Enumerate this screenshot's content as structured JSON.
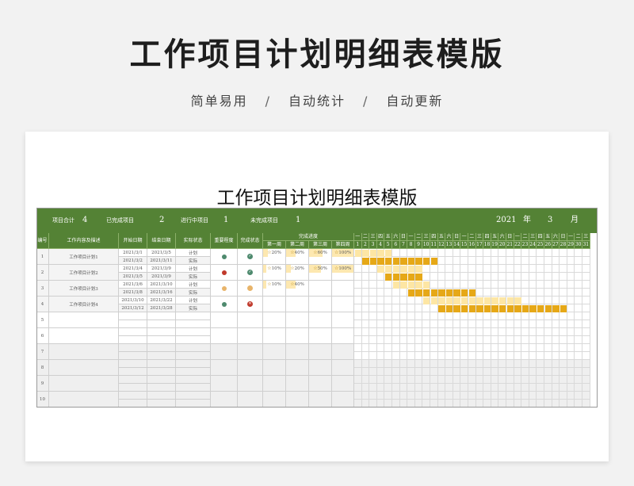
{
  "header": {
    "title": "工作项目计划明细表模版",
    "tagline": [
      "简单易用",
      "自动统计",
      "自动更新"
    ],
    "separator": "/"
  },
  "sheet": {
    "title": "工作项目计划明细表模版"
  },
  "summary": {
    "total_label": "项目合计",
    "total": "4",
    "done_label": "已完成项目",
    "done": "2",
    "progress_label": "进行中项目",
    "progress": "1",
    "undone_label": "未完成项目",
    "undone": "1",
    "year": "2021",
    "year_unit": "年",
    "month": "3",
    "month_unit": "月"
  },
  "columns": {
    "no": "编号",
    "content": "工作内容及描述",
    "start": "开始日期",
    "end": "结束日期",
    "status": "实际状态",
    "priority": "重要程度",
    "complete": "完成状态",
    "progress": "完成进度",
    "weeks": [
      "第一周",
      "第二周",
      "第三周",
      "第四周"
    ]
  },
  "weekdays": [
    "一",
    "二",
    "三",
    "四",
    "五",
    "六",
    "日",
    "一",
    "二",
    "三",
    "四",
    "五",
    "六",
    "日",
    "一",
    "二",
    "三",
    "四",
    "五",
    "六",
    "日",
    "一",
    "二",
    "三",
    "四",
    "五",
    "六",
    "日",
    "一",
    "二",
    "三"
  ],
  "days": [
    "1",
    "2",
    "3",
    "4",
    "5",
    "6",
    "7",
    "8",
    "9",
    "10",
    "11",
    "12",
    "13",
    "14",
    "15",
    "16",
    "17",
    "18",
    "19",
    "20",
    "21",
    "22",
    "23",
    "24",
    "25",
    "26",
    "27",
    "28",
    "29",
    "30",
    "31"
  ],
  "plan_label": "计划",
  "actual_label": "实际",
  "projects": [
    {
      "no": "1",
      "name": "工作项目计划1",
      "plan_start": "2021/3/1",
      "plan_end": "2021/3/5",
      "act_start": "2021/3/2",
      "act_end": "2021/3/11",
      "priority": "#4e8a6e",
      "complete": "ok",
      "weeks": [
        "20%",
        "40%",
        "60%",
        "100%"
      ]
    },
    {
      "no": "2",
      "name": "工作项目计划2",
      "plan_start": "2021/3/4",
      "plan_end": "2021/3/9",
      "act_start": "2021/3/5",
      "act_end": "2021/3/9",
      "priority": "#c0392b",
      "complete": "ok",
      "weeks": [
        "10%",
        "20%",
        "50%",
        "100%"
      ]
    },
    {
      "no": "3",
      "name": "工作项目计划3",
      "plan_start": "2021/3/6",
      "plan_end": "2021/3/10",
      "act_start": "2021/3/8",
      "act_end": "2021/3/16",
      "priority": "#e8b46a",
      "complete": "pending",
      "weeks": [
        "10%",
        "40%",
        "",
        ""
      ]
    },
    {
      "no": "4",
      "name": "工作项目计划4",
      "plan_start": "2021/3/10",
      "plan_end": "2021/3/22",
      "act_start": "2021/3/12",
      "act_end": "2021/3/28",
      "priority": "#4e8a6e",
      "complete": "fail",
      "weeks": [
        "",
        "",
        "",
        ""
      ]
    }
  ],
  "empty_rows": [
    "5",
    "6",
    "7",
    "8",
    "9",
    "10"
  ],
  "colors": {
    "green": "#548235",
    "plan_bar": "#fde6a4",
    "actual_bar": "#e6a817",
    "week_fill": "#fde8b0"
  }
}
